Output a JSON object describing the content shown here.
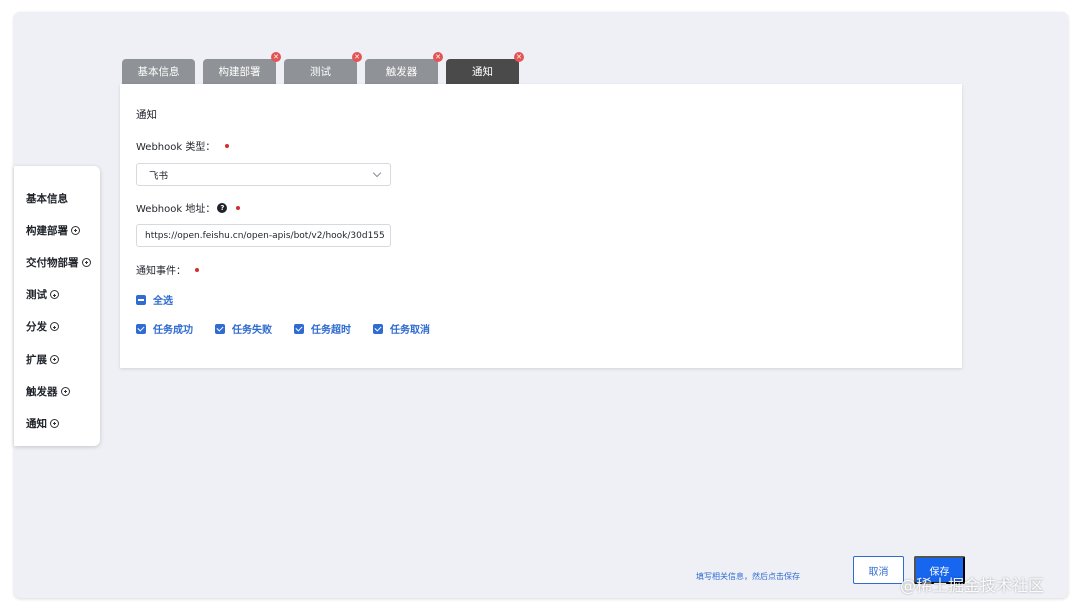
{
  "sidebar": {
    "items": [
      {
        "label": "基本信息",
        "has_plus": false
      },
      {
        "label": "构建部署",
        "has_plus": true
      },
      {
        "label": "交付物部署",
        "has_plus": true
      },
      {
        "label": "测试",
        "has_plus": true
      },
      {
        "label": "分发",
        "has_plus": true
      },
      {
        "label": "扩展",
        "has_plus": true
      },
      {
        "label": "触发器",
        "has_plus": true
      },
      {
        "label": "通知",
        "has_plus": true
      }
    ]
  },
  "tabs": [
    {
      "label": "基本信息",
      "closable": false,
      "active": false
    },
    {
      "label": "构建部署",
      "closable": true,
      "active": false
    },
    {
      "label": "测试",
      "closable": true,
      "active": false
    },
    {
      "label": "触发器",
      "closable": true,
      "active": false
    },
    {
      "label": "通知",
      "closable": true,
      "active": true
    }
  ],
  "form": {
    "section_title": "通知",
    "webhook_type_label": "Webhook 类型：",
    "webhook_type_value": "飞书",
    "webhook_url_label": "Webhook 地址：",
    "webhook_url_value": "https://open.feishu.cn/open-apis/bot/v2/hook/30d155",
    "events_label": "通知事件：",
    "select_all_label": "全选",
    "events": [
      {
        "label": "任务成功",
        "checked": true
      },
      {
        "label": "任务失败",
        "checked": true
      },
      {
        "label": "任务超时",
        "checked": true
      },
      {
        "label": "任务取消",
        "checked": true
      }
    ]
  },
  "footer": {
    "hint": "填写相关信息，然后点击保存",
    "cancel_label": "取消",
    "save_label": "保存"
  },
  "watermark": "@稀土掘金技术社区",
  "colors": {
    "accent": "#2f6bd1",
    "primary_button": "#1766f0",
    "required": "#d32f2f",
    "tab_inactive": "#8f9296",
    "tab_active": "#4a4a4a",
    "background": "#eef0f5"
  },
  "icons": {
    "help": "question-circle-icon",
    "close": "close-icon",
    "dropdown": "chevron-down-icon",
    "add": "plus-circle-icon"
  }
}
